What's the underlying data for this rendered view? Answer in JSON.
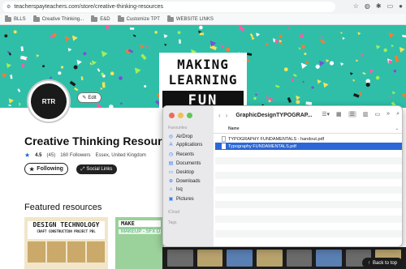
{
  "browser": {
    "url": "teacherspayteachers.com/store/creative-thinking-resources",
    "bookmarks": [
      "BLLS",
      "Creative Thinking...",
      "E&D",
      "Customize TPT",
      "WEBSITE LINKS"
    ]
  },
  "banner": {
    "line1": "MAKING",
    "line2": "LEARNING",
    "line3": "FUN",
    "bg_color": "#2fbfa8"
  },
  "store": {
    "avatar_text": "RTR",
    "edit_label": "Edit",
    "title": "Creative Thinking Resources",
    "rating": "4.5",
    "reviews": "(45)",
    "followers": "160 Followers",
    "location": "Essex, United Kingdom",
    "following_label": "Following",
    "social_label": "Social Links"
  },
  "featured": {
    "heading": "Featured resources",
    "thumb1_title": "DESIGN TECHNOLOGY",
    "thumb1_sub": "CRAFT CONSTRUCTION PROJECT PBL",
    "thumb2_title": "MAKE",
    "thumb2_sub": "MAKEUP - SFX D"
  },
  "back_to_top": "Back to top",
  "finder": {
    "title": "GraphicDesignTYPOGRAP...",
    "sidebar_favorites": "Favourites",
    "sidebar_items": [
      "AirDrop",
      "Applications",
      "Recents",
      "Documents",
      "Desktop",
      "Downloads",
      "lsq",
      "Pictures"
    ],
    "sidebar_icloud": "iCloud",
    "sidebar_tags": "Tags",
    "column_name": "Name",
    "files": [
      "TYPOGRAPHY FUNDAMENTALS - handout.pdf",
      "Typography FUNDAMENTALS.pdf"
    ]
  }
}
